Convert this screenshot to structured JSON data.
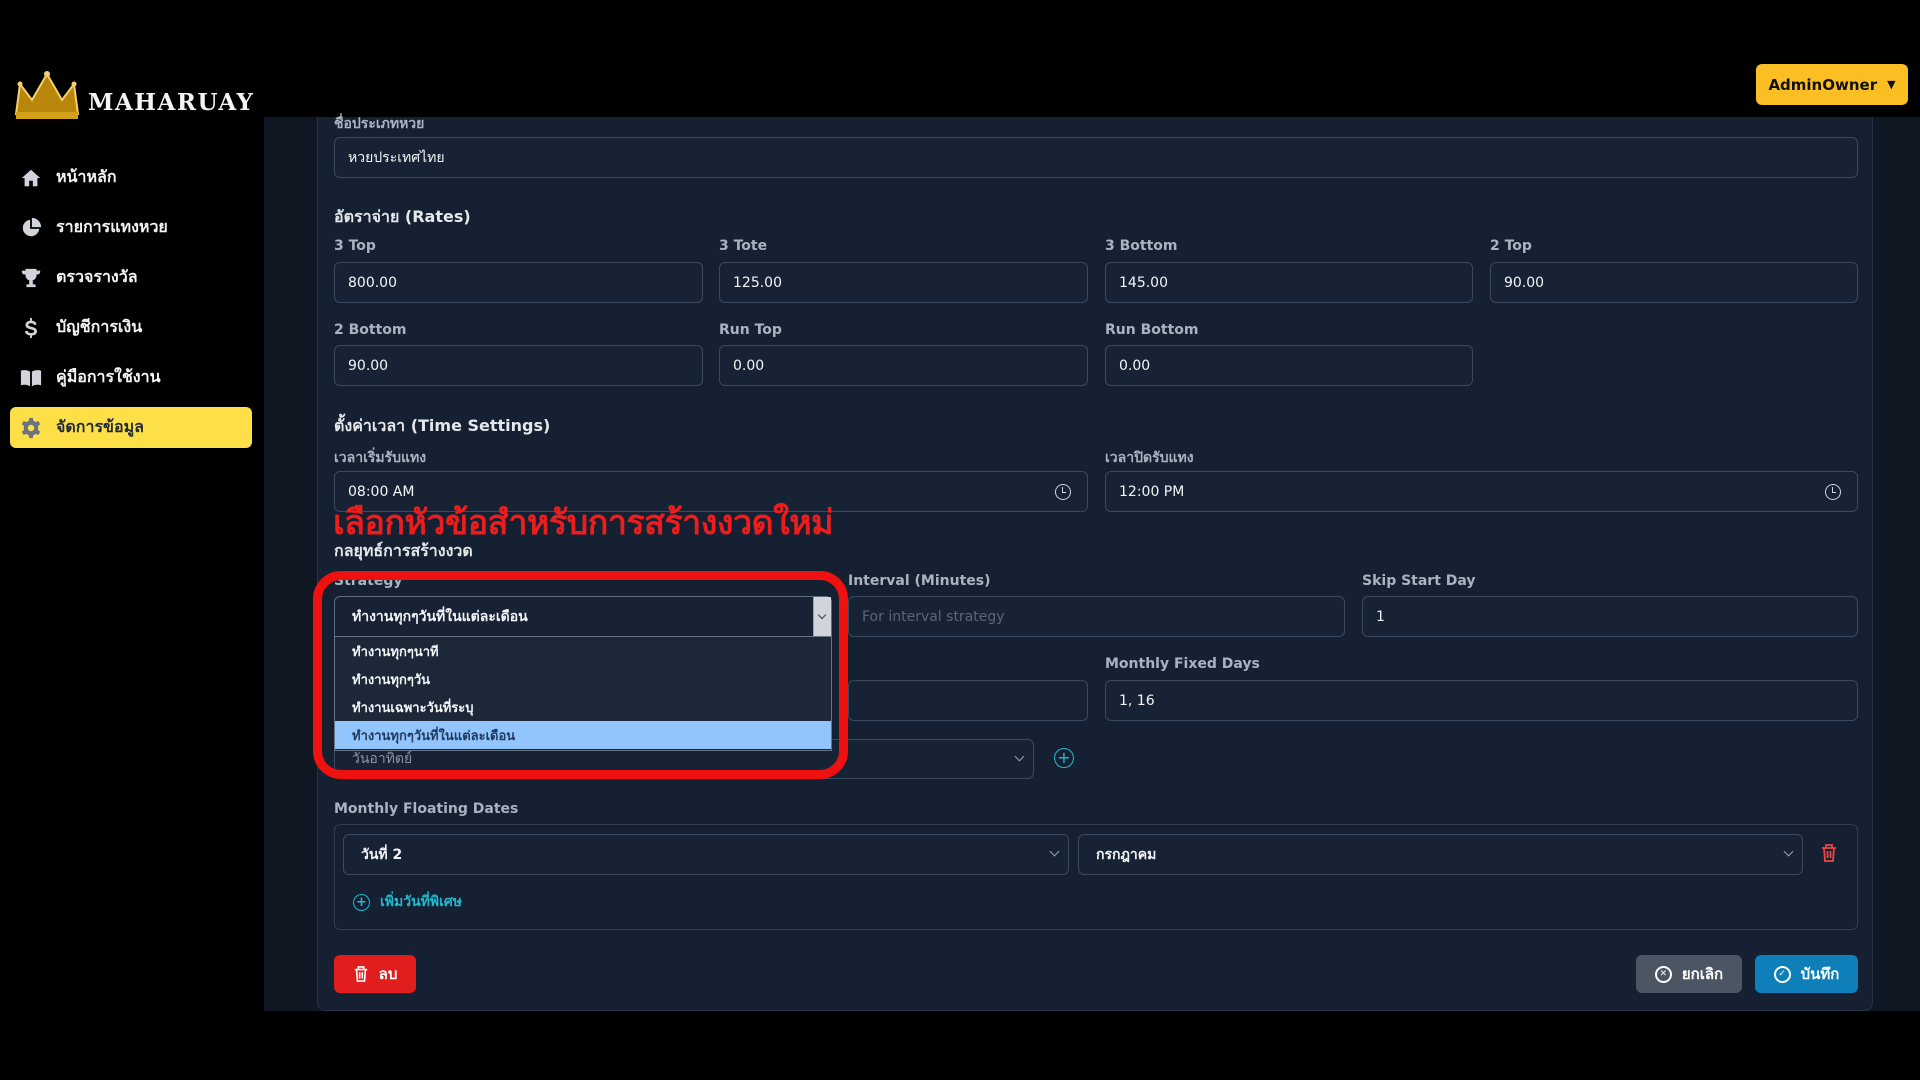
{
  "header": {
    "user_menu_label": "AdminOwner"
  },
  "brand": {
    "logo_text": "MAHARUAY"
  },
  "sidebar": {
    "items": [
      {
        "label": "หน้าหลัก",
        "icon": "home-icon"
      },
      {
        "label": "รายการแทงหวย",
        "icon": "pie-chart-icon"
      },
      {
        "label": "ตรวจรางวัล",
        "icon": "trophy-icon"
      },
      {
        "label": "บัญชีการเงิน",
        "icon": "dollar-icon"
      },
      {
        "label": "คู่มือการใช้งาน",
        "icon": "book-icon"
      },
      {
        "label": "จัดการข้อมูล",
        "icon": "gear-icon",
        "active": true
      }
    ]
  },
  "form": {
    "country_label": "ชื่อประเภทหวย",
    "country_value": "หวยประเทศไทย",
    "rates_title": "อัตราจ่าย (Rates)",
    "rates": {
      "three_top": {
        "label": "3 Top",
        "value": "800.00"
      },
      "three_tote": {
        "label": "3 Tote",
        "value": "125.00"
      },
      "three_bottom": {
        "label": "3 Bottom",
        "value": "145.00"
      },
      "two_top": {
        "label": "2 Top",
        "value": "90.00"
      },
      "two_bottom": {
        "label": "2 Bottom",
        "value": "90.00"
      },
      "run_top": {
        "label": "Run Top",
        "value": "0.00"
      },
      "run_bottom": {
        "label": "Run Bottom",
        "value": "0.00"
      }
    },
    "time_title": "ตั้งค่าเวลา (Time Settings)",
    "open_time_label": "เวลาเริ่มรับแทง",
    "open_time_value": "08:00 AM",
    "close_time_label": "เวลาปิดรับแทง",
    "close_time_value": "12:00 PM",
    "strategy_title": "กลยุทธ์การสร้างงวด",
    "strategy_label": "Strategy",
    "strategy_value": "ทำงานทุกๆวันที่ในแต่ละเดือน",
    "strategy_options": [
      "ทำงานทุกๆนาที",
      "ทำงานทุกๆวัน",
      "ทำงานเฉพาะวันที่ระบุ",
      "ทำงานทุกๆวันที่ในแต่ละเดือน"
    ],
    "strategy_selected_index": 3,
    "interval_label": "Interval (Minutes)",
    "interval_placeholder": "For interval strategy",
    "skip_label": "Skip Start Day",
    "skip_value": "1",
    "monthly_fixed_label": "Monthly Fixed Days",
    "monthly_fixed_value": "1, 16",
    "weekday_value": "วันอาทิตย์",
    "floating_label": "Monthly Floating Dates",
    "floating_day_value": "วันที่ 2",
    "floating_month_value": "กรกฎาคม",
    "add_special_label": "เพิ่มวันที่พิเศษ"
  },
  "actions": {
    "delete_label": "ลบ",
    "cancel_label": "ยกเลิก",
    "save_label": "บันทึก"
  },
  "annotation": {
    "text": "เลือกหัวข้อสำหรับการสร้างงวดใหม่",
    "color": "#ef1c1c"
  },
  "colors": {
    "accent_yellow": "#fbbf24",
    "danger": "#e11d1d",
    "primary": "#0e7fb8",
    "link": "#22b8cf"
  }
}
